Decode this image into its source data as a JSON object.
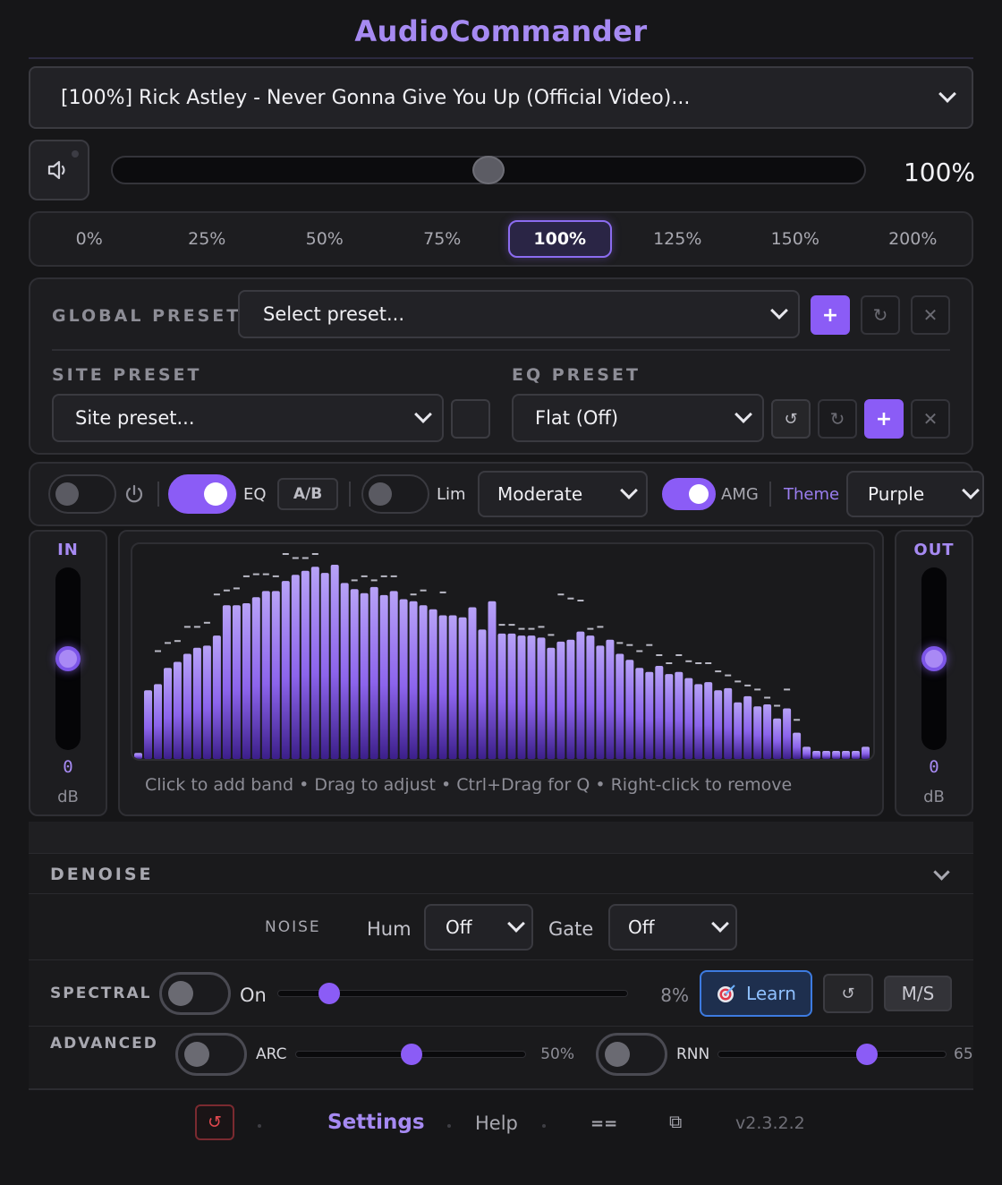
{
  "app": {
    "title": "AudioCommander",
    "version": "v2.3.2.2"
  },
  "tab_select": {
    "value": "[100%] Rick Astley - Never Gonna Give You Up (Official Video)..."
  },
  "volume": {
    "value_label": "100%",
    "level": 0.5
  },
  "volume_presets": [
    {
      "label": "0%"
    },
    {
      "label": "25%"
    },
    {
      "label": "50%"
    },
    {
      "label": "75%"
    },
    {
      "label": "100%",
      "active": true
    },
    {
      "label": "125%"
    },
    {
      "label": "150%"
    },
    {
      "label": "200%"
    }
  ],
  "global_preset": {
    "label": "GLOBAL PRESET:",
    "value": "Select preset...",
    "add": "+",
    "refresh": "↻",
    "delete": "✕"
  },
  "site_preset": {
    "label": "SITE PRESET",
    "value": "Site preset..."
  },
  "eq_preset": {
    "label": "EQ PRESET",
    "value": "Flat (Off)",
    "undo": "↺",
    "redo": "↻",
    "add": "+",
    "delete": "✕"
  },
  "controls": {
    "eq_label": "EQ",
    "ab_label": "A/B",
    "lim_label": "Lim",
    "limiter_mode": "Moderate",
    "amg_label": "AMG",
    "theme_label": "Theme",
    "theme_value": "Purple",
    "power_on": false,
    "eq_on": true,
    "lim_on": false,
    "amg_on": true
  },
  "meters": {
    "in": {
      "label": "IN",
      "value": "0",
      "unit": "dB",
      "level": 0.5
    },
    "out": {
      "label": "OUT",
      "value": "0",
      "unit": "dB",
      "level": 0.5
    }
  },
  "spectrum": {
    "hint": "Click to add band • Drag to adjust • Ctrl+Drag for Q • Right-click to remove",
    "bars": [
      0.03,
      0.34,
      0.37,
      0.45,
      0.48,
      0.52,
      0.55,
      0.56,
      0.61,
      0.76,
      0.76,
      0.77,
      0.8,
      0.83,
      0.83,
      0.88,
      0.91,
      0.93,
      0.95,
      0.92,
      0.96,
      0.87,
      0.84,
      0.82,
      0.85,
      0.81,
      0.83,
      0.79,
      0.78,
      0.76,
      0.74,
      0.71,
      0.71,
      0.7,
      0.75,
      0.64,
      0.78,
      0.62,
      0.62,
      0.61,
      0.61,
      0.6,
      0.55,
      0.58,
      0.59,
      0.63,
      0.61,
      0.56,
      0.59,
      0.52,
      0.49,
      0.45,
      0.43,
      0.46,
      0.42,
      0.43,
      0.4,
      0.37,
      0.38,
      0.34,
      0.35,
      0.28,
      0.31,
      0.26,
      0.27,
      0.2,
      0.25,
      0.13,
      0.06,
      0.04,
      0.04,
      0.04,
      0.04,
      0.04,
      0.06
    ],
    "peaks": [
      0.03,
      0.34,
      0.52,
      0.56,
      0.57,
      0.64,
      0.64,
      0.66,
      0.8,
      0.82,
      0.83,
      0.89,
      0.9,
      0.9,
      0.89,
      1.0,
      0.98,
      0.98,
      1.0,
      0.92,
      0.97,
      0.86,
      0.87,
      0.89,
      0.87,
      0.89,
      0.89,
      0.79,
      0.8,
      0.82,
      0.75,
      0.81,
      0.71,
      0.71,
      0.75,
      0.64,
      0.78,
      0.65,
      0.65,
      0.63,
      0.63,
      0.64,
      0.6,
      0.8,
      0.78,
      0.77,
      0.63,
      0.64,
      0.59,
      0.56,
      0.55,
      0.52,
      0.55,
      0.5,
      0.46,
      0.5,
      0.47,
      0.46,
      0.46,
      0.42,
      0.4,
      0.37,
      0.35,
      0.33,
      0.29,
      0.25,
      0.33,
      0.18,
      0.06,
      0.04,
      0.04,
      0.04,
      0.04,
      0.04,
      0.06
    ]
  },
  "denoise": {
    "header": "DENOISE",
    "noise_label": "NOISE",
    "hum_label": "Hum",
    "hum_value": "Off",
    "gate_label": "Gate",
    "gate_value": "Off",
    "spectral_label": "SPECTRAL",
    "spectral_on_label": "On",
    "spectral_value": "8%",
    "spectral_level": 0.08,
    "learn_label": "Learn",
    "reset_label": "↺",
    "ms_label": "M/S",
    "advanced_label": "ADVANCED",
    "arc_label": "ARC",
    "arc_value": "50%",
    "arc_level": 0.5,
    "rnn_label": "RNN",
    "rnn_value": "65"
  },
  "footer": {
    "reset": "↺",
    "settings": "Settings",
    "help": "Help",
    "menu": "==",
    "copy": "⧉"
  }
}
